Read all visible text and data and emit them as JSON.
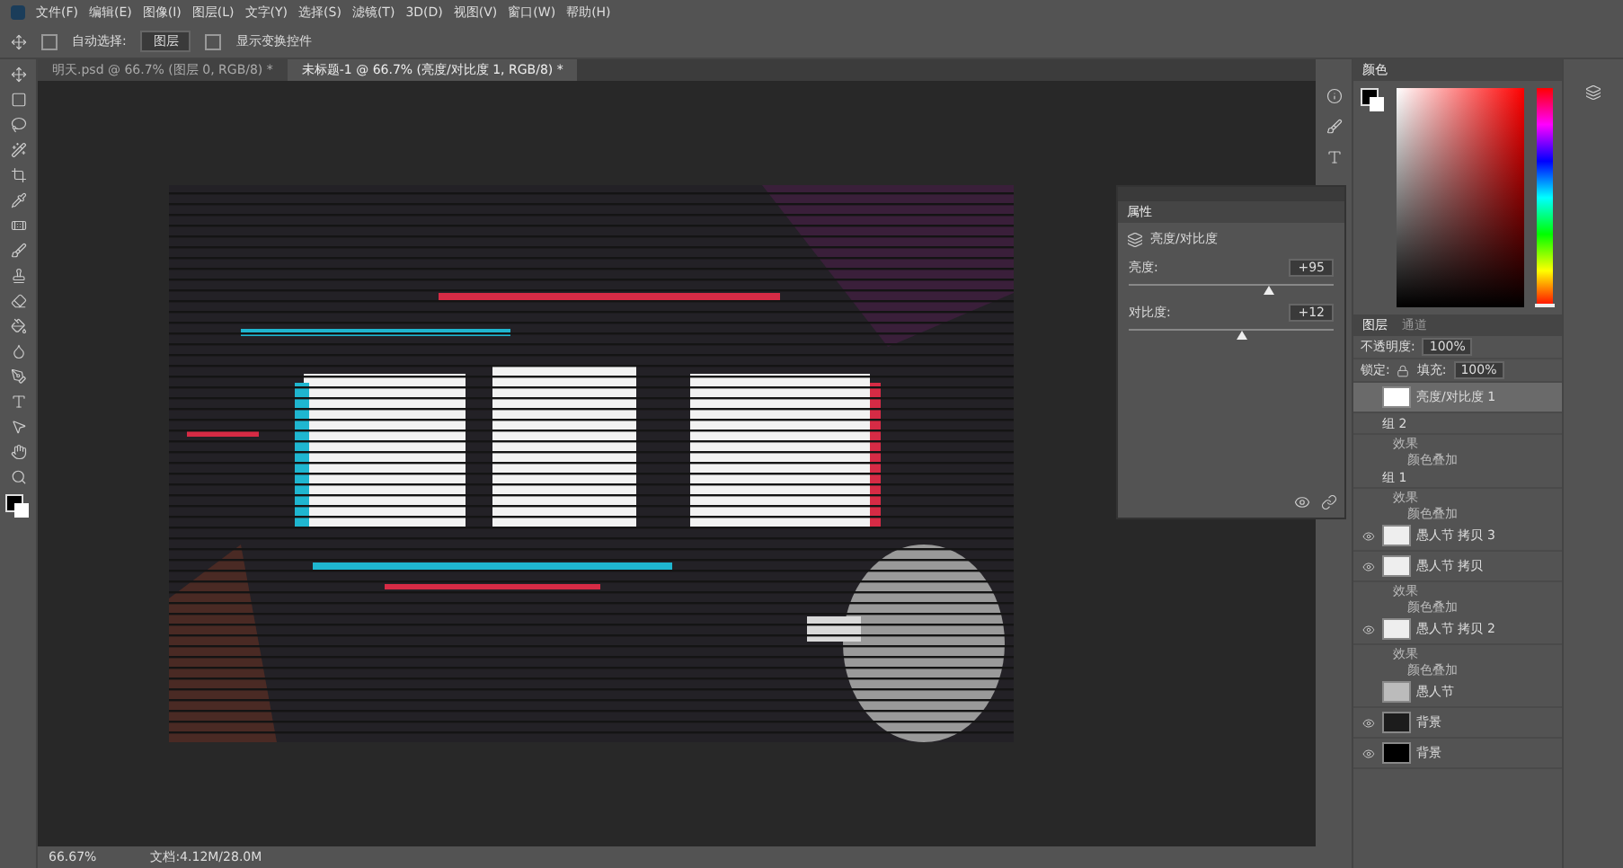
{
  "menu": [
    "文件(F)",
    "编辑(E)",
    "图像(I)",
    "图层(L)",
    "文字(Y)",
    "选择(S)",
    "滤镜(T)",
    "3D(D)",
    "视图(V)",
    "窗口(W)",
    "帮助(H)"
  ],
  "options": {
    "auto_select": {
      "label": "自动选择:",
      "checked": false
    },
    "target": "图层",
    "transform": {
      "label": "显示变换控件",
      "checked": false
    }
  },
  "doc_tabs": [
    {
      "label": "明天.psd @ 66.7% (图层 0, RGB/8) *",
      "selected": false
    },
    {
      "label": "未标题-1 @ 66.7% (亮度/对比度 1, RGB/8) *",
      "selected": true
    }
  ],
  "properties": {
    "title": "属性",
    "adjustment": "亮度/对比度",
    "sliders": [
      {
        "label": "亮度:",
        "reading": "+95",
        "level": 0.68
      },
      {
        "label": "对比度:",
        "reading": "+12",
        "level": 0.55
      }
    ]
  },
  "color_panel": {
    "title": "颜色",
    "hue": {
      "level": 0
    }
  },
  "layers_panel": {
    "tabs": [
      {
        "label": "图层",
        "selected": true
      },
      {
        "label": "通道",
        "selected": false
      }
    ],
    "opacity": {
      "label": "不透明度:",
      "value": "100%"
    },
    "fill": {
      "label": "填充:",
      "value": "100%"
    },
    "lock_label": "锁定:",
    "layers": [
      {
        "kind": "adjustment",
        "name": "亮度/对比度 1",
        "selected": true,
        "visible": false
      },
      {
        "kind": "group",
        "name": "组 2",
        "selected": false,
        "visible": false,
        "children": [
          {
            "name": "效果",
            "children": [
              {
                "name": "颜色叠加"
              }
            ]
          }
        ]
      },
      {
        "kind": "group",
        "name": "组 1",
        "selected": false,
        "visible": false,
        "children": [
          {
            "name": "效果",
            "children": [
              {
                "name": "颜色叠加"
              }
            ]
          }
        ]
      },
      {
        "kind": "text",
        "name": "愚人节 拷贝 3",
        "selected": false,
        "visible": true
      },
      {
        "kind": "text",
        "name": "愚人节 拷贝",
        "selected": false,
        "visible": true,
        "children": [
          {
            "name": "效果",
            "children": [
              {
                "name": "颜色叠加"
              }
            ]
          }
        ]
      },
      {
        "kind": "text",
        "name": "愚人节 拷贝 2",
        "selected": false,
        "visible": true,
        "children": [
          {
            "name": "效果",
            "children": [
              {
                "name": "颜色叠加"
              }
            ]
          }
        ]
      },
      {
        "name": "愚人节",
        "selected": false,
        "visible": false
      },
      {
        "kind": "dark",
        "name": "背景",
        "selected": false,
        "visible": true
      },
      {
        "kind": "black",
        "name": "背景",
        "selected": false,
        "visible": true
      }
    ]
  },
  "status": {
    "zoom": "66.67%",
    "doc": "文档:4.12M/28.0M"
  }
}
